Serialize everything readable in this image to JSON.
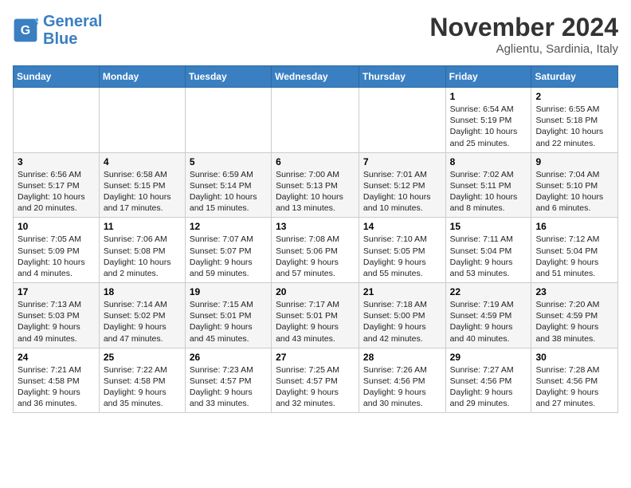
{
  "header": {
    "logo_line1": "General",
    "logo_line2": "Blue",
    "month": "November 2024",
    "location": "Aglientu, Sardinia, Italy"
  },
  "weekdays": [
    "Sunday",
    "Monday",
    "Tuesday",
    "Wednesday",
    "Thursday",
    "Friday",
    "Saturday"
  ],
  "weeks": [
    [
      {
        "day": "",
        "info": ""
      },
      {
        "day": "",
        "info": ""
      },
      {
        "day": "",
        "info": ""
      },
      {
        "day": "",
        "info": ""
      },
      {
        "day": "",
        "info": ""
      },
      {
        "day": "1",
        "info": "Sunrise: 6:54 AM\nSunset: 5:19 PM\nDaylight: 10 hours\nand 25 minutes."
      },
      {
        "day": "2",
        "info": "Sunrise: 6:55 AM\nSunset: 5:18 PM\nDaylight: 10 hours\nand 22 minutes."
      }
    ],
    [
      {
        "day": "3",
        "info": "Sunrise: 6:56 AM\nSunset: 5:17 PM\nDaylight: 10 hours\nand 20 minutes."
      },
      {
        "day": "4",
        "info": "Sunrise: 6:58 AM\nSunset: 5:15 PM\nDaylight: 10 hours\nand 17 minutes."
      },
      {
        "day": "5",
        "info": "Sunrise: 6:59 AM\nSunset: 5:14 PM\nDaylight: 10 hours\nand 15 minutes."
      },
      {
        "day": "6",
        "info": "Sunrise: 7:00 AM\nSunset: 5:13 PM\nDaylight: 10 hours\nand 13 minutes."
      },
      {
        "day": "7",
        "info": "Sunrise: 7:01 AM\nSunset: 5:12 PM\nDaylight: 10 hours\nand 10 minutes."
      },
      {
        "day": "8",
        "info": "Sunrise: 7:02 AM\nSunset: 5:11 PM\nDaylight: 10 hours\nand 8 minutes."
      },
      {
        "day": "9",
        "info": "Sunrise: 7:04 AM\nSunset: 5:10 PM\nDaylight: 10 hours\nand 6 minutes."
      }
    ],
    [
      {
        "day": "10",
        "info": "Sunrise: 7:05 AM\nSunset: 5:09 PM\nDaylight: 10 hours\nand 4 minutes."
      },
      {
        "day": "11",
        "info": "Sunrise: 7:06 AM\nSunset: 5:08 PM\nDaylight: 10 hours\nand 2 minutes."
      },
      {
        "day": "12",
        "info": "Sunrise: 7:07 AM\nSunset: 5:07 PM\nDaylight: 9 hours\nand 59 minutes."
      },
      {
        "day": "13",
        "info": "Sunrise: 7:08 AM\nSunset: 5:06 PM\nDaylight: 9 hours\nand 57 minutes."
      },
      {
        "day": "14",
        "info": "Sunrise: 7:10 AM\nSunset: 5:05 PM\nDaylight: 9 hours\nand 55 minutes."
      },
      {
        "day": "15",
        "info": "Sunrise: 7:11 AM\nSunset: 5:04 PM\nDaylight: 9 hours\nand 53 minutes."
      },
      {
        "day": "16",
        "info": "Sunrise: 7:12 AM\nSunset: 5:04 PM\nDaylight: 9 hours\nand 51 minutes."
      }
    ],
    [
      {
        "day": "17",
        "info": "Sunrise: 7:13 AM\nSunset: 5:03 PM\nDaylight: 9 hours\nand 49 minutes."
      },
      {
        "day": "18",
        "info": "Sunrise: 7:14 AM\nSunset: 5:02 PM\nDaylight: 9 hours\nand 47 minutes."
      },
      {
        "day": "19",
        "info": "Sunrise: 7:15 AM\nSunset: 5:01 PM\nDaylight: 9 hours\nand 45 minutes."
      },
      {
        "day": "20",
        "info": "Sunrise: 7:17 AM\nSunset: 5:01 PM\nDaylight: 9 hours\nand 43 minutes."
      },
      {
        "day": "21",
        "info": "Sunrise: 7:18 AM\nSunset: 5:00 PM\nDaylight: 9 hours\nand 42 minutes."
      },
      {
        "day": "22",
        "info": "Sunrise: 7:19 AM\nSunset: 4:59 PM\nDaylight: 9 hours\nand 40 minutes."
      },
      {
        "day": "23",
        "info": "Sunrise: 7:20 AM\nSunset: 4:59 PM\nDaylight: 9 hours\nand 38 minutes."
      }
    ],
    [
      {
        "day": "24",
        "info": "Sunrise: 7:21 AM\nSunset: 4:58 PM\nDaylight: 9 hours\nand 36 minutes."
      },
      {
        "day": "25",
        "info": "Sunrise: 7:22 AM\nSunset: 4:58 PM\nDaylight: 9 hours\nand 35 minutes."
      },
      {
        "day": "26",
        "info": "Sunrise: 7:23 AM\nSunset: 4:57 PM\nDaylight: 9 hours\nand 33 minutes."
      },
      {
        "day": "27",
        "info": "Sunrise: 7:25 AM\nSunset: 4:57 PM\nDaylight: 9 hours\nand 32 minutes."
      },
      {
        "day": "28",
        "info": "Sunrise: 7:26 AM\nSunset: 4:56 PM\nDaylight: 9 hours\nand 30 minutes."
      },
      {
        "day": "29",
        "info": "Sunrise: 7:27 AM\nSunset: 4:56 PM\nDaylight: 9 hours\nand 29 minutes."
      },
      {
        "day": "30",
        "info": "Sunrise: 7:28 AM\nSunset: 4:56 PM\nDaylight: 9 hours\nand 27 minutes."
      }
    ]
  ]
}
